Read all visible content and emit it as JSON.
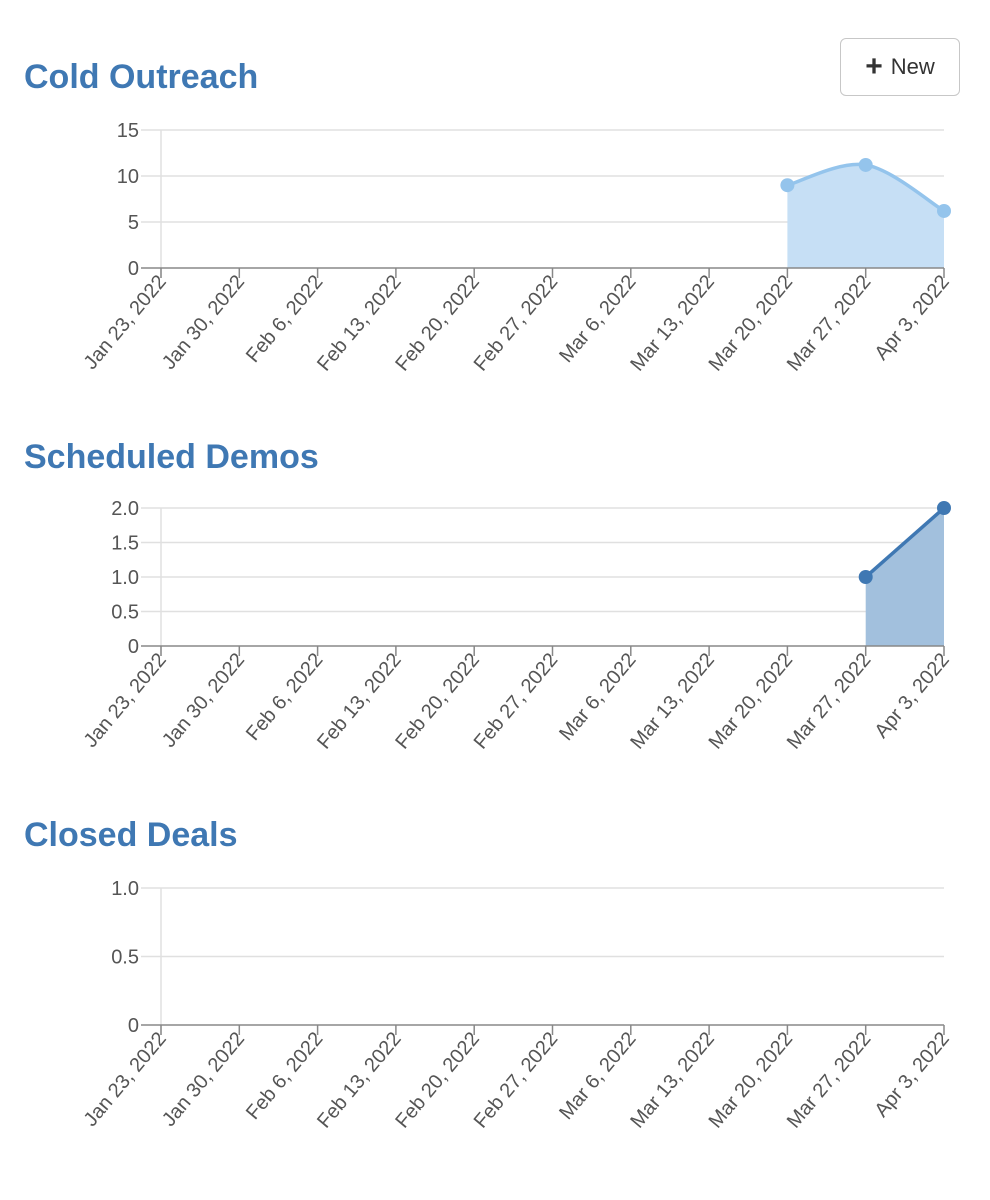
{
  "toolbar": {
    "new_label": "New",
    "new_icon": "plus-icon"
  },
  "colors": {
    "title": "#3f78b3",
    "light_series": "#94c4ec",
    "light_fill": "#c6dff5",
    "dark_series": "#3f78b3",
    "dark_fill": "#a2c0dd",
    "grid": "#e0e0e0",
    "axis": "#888888"
  },
  "chart_data": [
    {
      "type": "area",
      "title": "Cold Outreach",
      "x": [
        "Jan 23, 2022",
        "Jan 30, 2022",
        "Feb 6, 2022",
        "Feb 13, 2022",
        "Feb 20, 2022",
        "Feb 27, 2022",
        "Mar 6, 2022",
        "Mar 13, 2022",
        "Mar 20, 2022",
        "Mar 27, 2022",
        "Apr 3, 2022"
      ],
      "y_ticks": [
        "0",
        "5",
        "10",
        "15"
      ],
      "ylim": [
        0,
        15
      ],
      "series": [
        {
          "values": [
            null,
            null,
            null,
            null,
            null,
            null,
            null,
            null,
            9,
            11.2,
            6.2
          ]
        }
      ],
      "smooth": true,
      "style": "light",
      "grid": true
    },
    {
      "type": "area",
      "title": "Scheduled Demos",
      "x": [
        "Jan 23, 2022",
        "Jan 30, 2022",
        "Feb 6, 2022",
        "Feb 13, 2022",
        "Feb 20, 2022",
        "Feb 27, 2022",
        "Mar 6, 2022",
        "Mar 13, 2022",
        "Mar 20, 2022",
        "Mar 27, 2022",
        "Apr 3, 2022"
      ],
      "y_ticks": [
        "0",
        "0.5",
        "1.0",
        "1.5",
        "2.0"
      ],
      "ylim": [
        0,
        2
      ],
      "series": [
        {
          "values": [
            null,
            null,
            null,
            null,
            null,
            null,
            null,
            null,
            null,
            1,
            2
          ]
        }
      ],
      "smooth": false,
      "style": "dark",
      "grid": true
    },
    {
      "type": "area",
      "title": "Closed Deals",
      "x": [
        "Jan 23, 2022",
        "Jan 30, 2022",
        "Feb 6, 2022",
        "Feb 13, 2022",
        "Feb 20, 2022",
        "Feb 27, 2022",
        "Mar 6, 2022",
        "Mar 13, 2022",
        "Mar 20, 2022",
        "Mar 27, 2022",
        "Apr 3, 2022"
      ],
      "y_ticks": [
        "0",
        "0.5",
        "1.0"
      ],
      "ylim": [
        0,
        1
      ],
      "series": [
        {
          "values": [
            null,
            null,
            null,
            null,
            null,
            null,
            null,
            null,
            null,
            null,
            null
          ]
        }
      ],
      "smooth": false,
      "style": "light",
      "grid": true
    }
  ]
}
